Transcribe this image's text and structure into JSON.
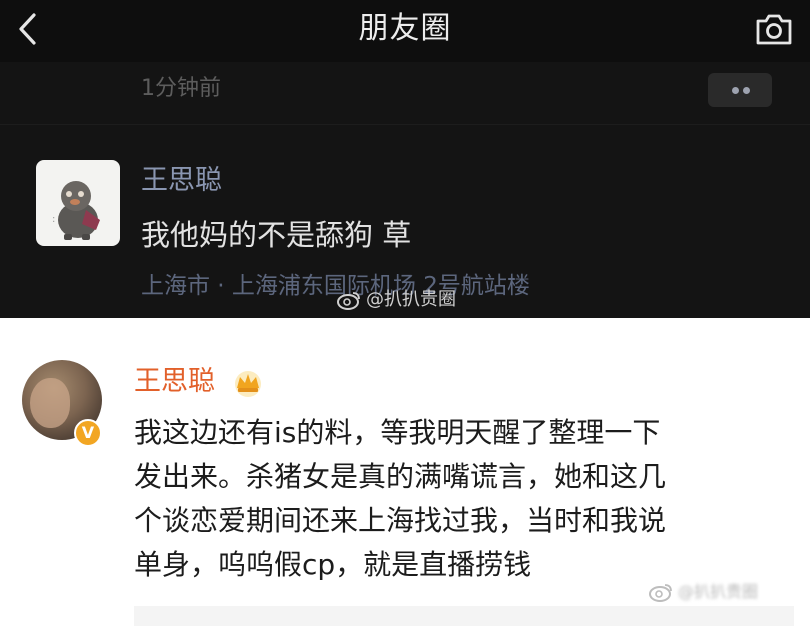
{
  "nav": {
    "title": "朋友圈",
    "back_icon": "chevron-left-icon",
    "camera_icon": "camera-icon"
  },
  "moment": {
    "time_ago": "1分钟前",
    "author": "王思聪",
    "text": "我他妈的不是舔狗 草",
    "location": "上海市 · 上海浦东国际机场 2号航站楼",
    "more_icon": "more-dots-icon"
  },
  "watermarks": {
    "top": "@扒扒贵圈",
    "bottom": "@扒扒贵圈"
  },
  "comment": {
    "author": "王思聪",
    "badge": "V",
    "text": "我这边还有is的料，等我明天醒了整理一下\n发出来。杀猪女是真的满嘴谎言，她和这几\n个谈恋爱期间还来上海找过我，当时和我说\n单身，呜呜假cp，就是直播捞钱",
    "crown_icon": "crown-icon"
  },
  "colors": {
    "dark_bg": "#141414",
    "link_name": "#8a96b1",
    "weibo_name": "#e2602a",
    "vip_badge": "#f2a623"
  }
}
